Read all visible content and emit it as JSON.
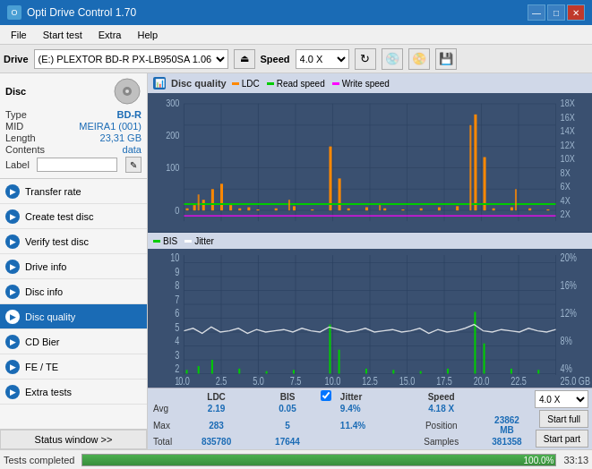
{
  "titlebar": {
    "title": "Opti Drive Control 1.70",
    "icon": "O",
    "min_label": "—",
    "max_label": "□",
    "close_label": "✕"
  },
  "menubar": {
    "items": [
      "File",
      "Start test",
      "Extra",
      "Help"
    ]
  },
  "drivebar": {
    "label": "Drive",
    "drive_value": "(E:) PLEXTOR BD-R  PX-LB950SA 1.06",
    "speed_label": "Speed",
    "speed_value": "4.0 X"
  },
  "disc": {
    "title": "Disc",
    "type_label": "Type",
    "type_value": "BD-R",
    "mid_label": "MID",
    "mid_value": "MEIRA1 (001)",
    "length_label": "Length",
    "length_value": "23,31 GB",
    "contents_label": "Contents",
    "contents_value": "data",
    "label_label": "Label",
    "label_value": ""
  },
  "nav": {
    "items": [
      {
        "id": "transfer-rate",
        "label": "Transfer rate",
        "active": false
      },
      {
        "id": "create-test-disc",
        "label": "Create test disc",
        "active": false
      },
      {
        "id": "verify-test-disc",
        "label": "Verify test disc",
        "active": false
      },
      {
        "id": "drive-info",
        "label": "Drive info",
        "active": false
      },
      {
        "id": "disc-info",
        "label": "Disc info",
        "active": false
      },
      {
        "id": "disc-quality",
        "label": "Disc quality",
        "active": true
      },
      {
        "id": "cd-bier",
        "label": "CD Bier",
        "active": false
      },
      {
        "id": "fe-te",
        "label": "FE / TE",
        "active": false
      },
      {
        "id": "extra-tests",
        "label": "Extra tests",
        "active": false
      }
    ]
  },
  "status_window_label": "Status window >>",
  "chart": {
    "title": "Disc quality",
    "legend": {
      "ldc_label": "LDC",
      "read_label": "Read speed",
      "write_label": "Write speed"
    },
    "upper_yaxis": [
      "300",
      "200",
      "100",
      "0"
    ],
    "upper_yaxis_right": [
      "18X",
      "16X",
      "14X",
      "12X",
      "10X",
      "8X",
      "6X",
      "4X",
      "2X"
    ],
    "lower_legend": {
      "bis_label": "BIS",
      "jitter_label": "Jitter"
    },
    "lower_yaxis": [
      "10",
      "9",
      "8",
      "7",
      "6",
      "5",
      "4",
      "3",
      "2",
      "1"
    ],
    "lower_yaxis_right": [
      "20%",
      "16%",
      "12%",
      "8%",
      "4%"
    ],
    "xaxis": [
      "0.0",
      "2.5",
      "5.0",
      "7.5",
      "10.0",
      "12.5",
      "15.0",
      "17.5",
      "20.0",
      "22.5",
      "25.0 GB"
    ]
  },
  "stats": {
    "headers": [
      "",
      "LDC",
      "BIS",
      "",
      "Jitter",
      "Speed",
      ""
    ],
    "avg_label": "Avg",
    "avg_ldc": "2.19",
    "avg_bis": "0.05",
    "avg_jitter": "9.4%",
    "avg_speed": "4.18 X",
    "max_label": "Max",
    "max_ldc": "283",
    "max_bis": "5",
    "max_jitter": "11.4%",
    "position_label": "Position",
    "position_value": "23862 MB",
    "total_label": "Total",
    "total_ldc": "835780",
    "total_bis": "17644",
    "samples_label": "Samples",
    "samples_value": "381358",
    "jitter_checked": true,
    "speed_select": "4.0 X",
    "start_full_label": "Start full",
    "start_part_label": "Start part"
  },
  "bottom": {
    "status_text": "Tests completed",
    "progress": 100,
    "progress_label": "100.0%",
    "time": "33:13"
  }
}
